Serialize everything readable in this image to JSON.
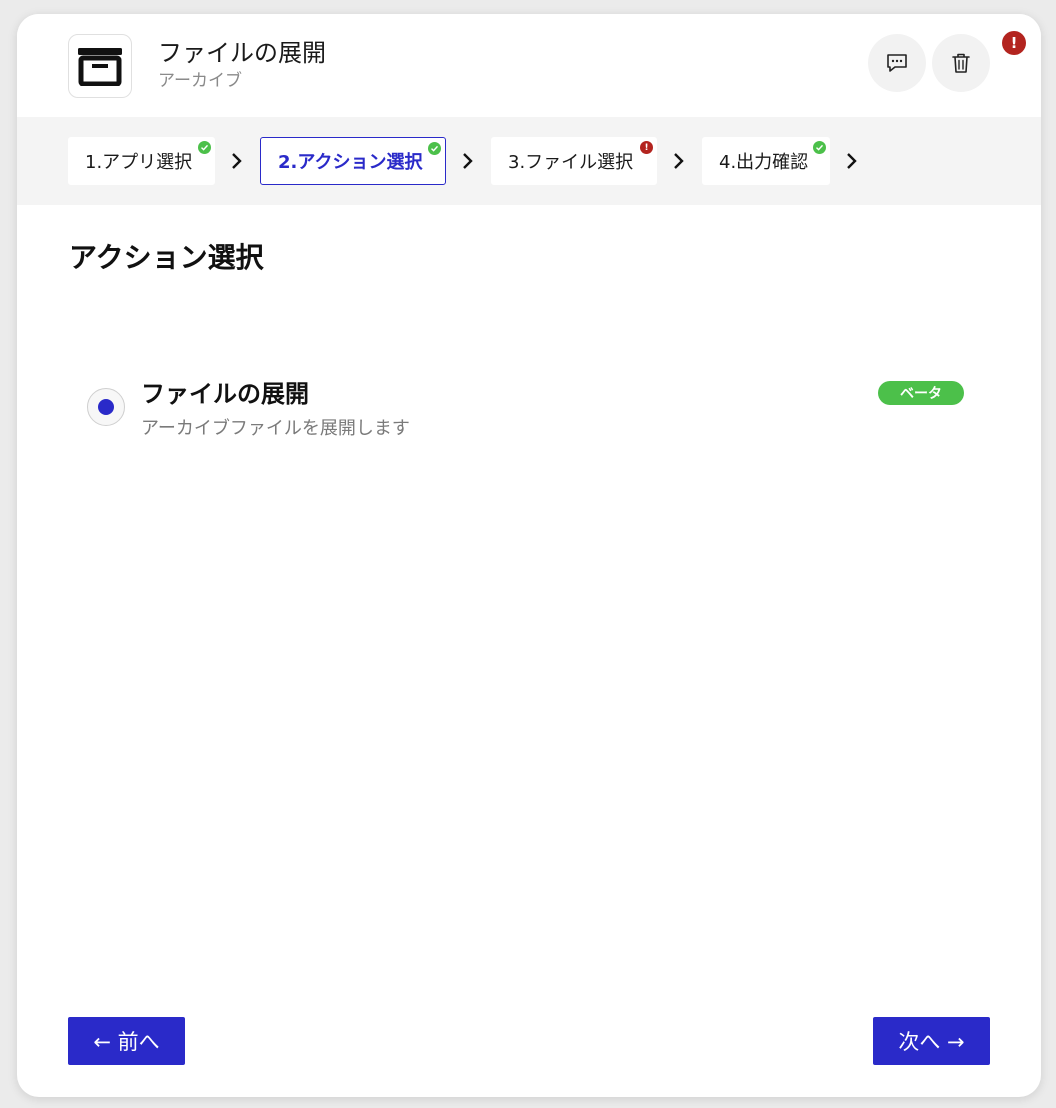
{
  "header": {
    "title": "ファイルの展開",
    "subtitle": "アーカイブ",
    "app_icon": "archive-box-icon",
    "alert_mark": "!"
  },
  "steps": [
    {
      "label": "1.アプリ選択",
      "status": "ok"
    },
    {
      "label": "2.アクション選択",
      "status": "ok",
      "active": true
    },
    {
      "label": "3.ファイル選択",
      "status": "error",
      "status_mark": "!"
    },
    {
      "label": "4.出力確認",
      "status": "ok"
    }
  ],
  "main": {
    "section_title": "アクション選択",
    "option": {
      "title": "ファイルの展開",
      "description": "アーカイブファイルを展開します",
      "badge": "ベータ",
      "selected": true
    }
  },
  "footer": {
    "prev_label": "← 前へ",
    "next_label": "次へ →"
  },
  "colors": {
    "accent": "#2a2ac9",
    "success": "#4cc04a",
    "error": "#b3241f",
    "stepbar_bg": "#f4f4f4"
  }
}
